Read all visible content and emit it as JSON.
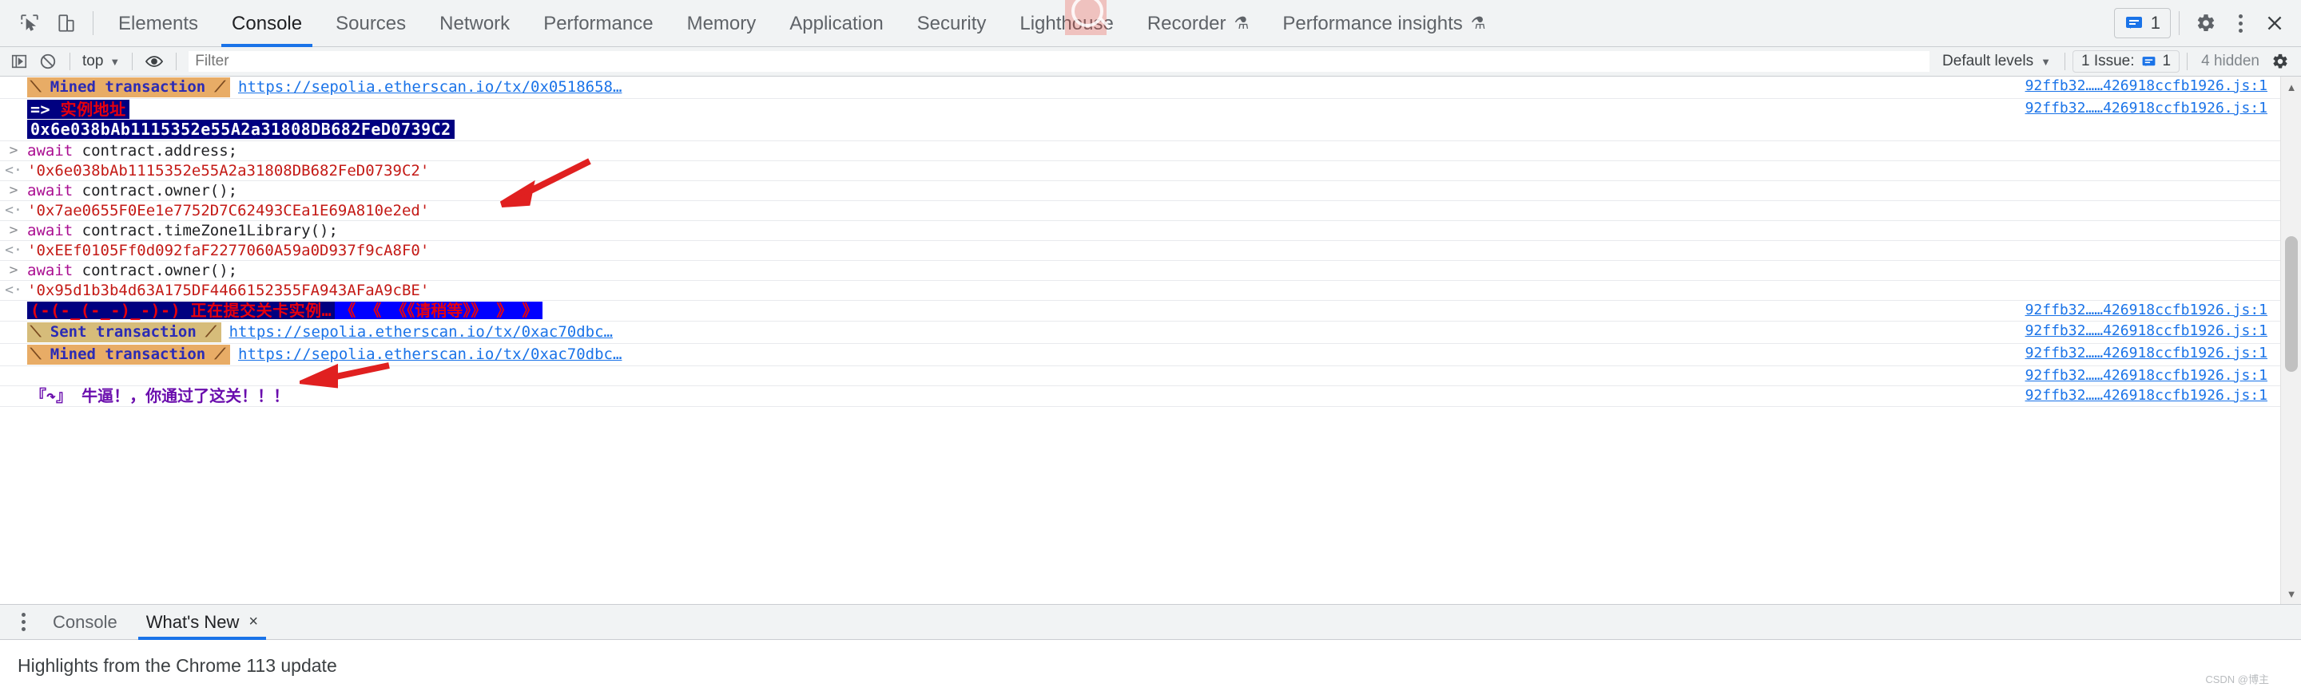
{
  "toolbar": {
    "inspect_icon": "inspect-element-icon",
    "device_icon": "device-toolbar-icon",
    "tabs": [
      {
        "label": "Elements",
        "active": false,
        "badge": ""
      },
      {
        "label": "Console",
        "active": true,
        "badge": ""
      },
      {
        "label": "Sources",
        "active": false,
        "badge": ""
      },
      {
        "label": "Network",
        "active": false,
        "badge": ""
      },
      {
        "label": "Performance",
        "active": false,
        "badge": ""
      },
      {
        "label": "Memory",
        "active": false,
        "badge": ""
      },
      {
        "label": "Application",
        "active": false,
        "badge": ""
      },
      {
        "label": "Security",
        "active": false,
        "badge": ""
      },
      {
        "label": "Lighthouse",
        "active": false,
        "badge": ""
      },
      {
        "label": "Recorder",
        "active": false,
        "badge": "⚗"
      },
      {
        "label": "Performance insights",
        "active": false,
        "badge": "⚗"
      }
    ],
    "issues_badge_count": "1",
    "settings_label": "gear-icon",
    "more_label": "more-options-icon",
    "close_label": "close-icon"
  },
  "console_toolbar": {
    "sidebar_toggle": "console-sidebar-toggle",
    "clear_label": "clear-console-icon",
    "context": "top",
    "eye_label": "live-expressions-icon",
    "filter_placeholder": "Filter",
    "filter_value": "",
    "levels": "Default levels",
    "issues_text": "1 Issue:",
    "issues_count": "1",
    "hidden_text": "4 hidden",
    "settings_label": "console-settings-icon"
  },
  "console": {
    "rows": [
      {
        "type": "styled-badge",
        "gutter": "",
        "badge": "Mined transaction",
        "badge_variant": "mined",
        "link": "https://sepolia.etherscan.io/tx/0x0518658…",
        "source": "92ffb32……426918ccfb1926.js:1"
      },
      {
        "type": "navy-two-line",
        "gutter": "",
        "line1_prefix": "=>",
        "line1": "实例地址",
        "line2": "0x6e038bAb1115352e55A2a31808DB682FeD0739C2",
        "source": "92ffb32……426918ccfb1926.js:1"
      },
      {
        "type": "input",
        "gutter": ">",
        "keyword": "await",
        "code": " contract.address;",
        "source": ""
      },
      {
        "type": "output",
        "gutter": "<·",
        "value": "'0x6e038bAb1115352e55A2a31808DB682FeD0739C2'",
        "source": ""
      },
      {
        "type": "input",
        "gutter": ">",
        "keyword": "await",
        "code": " contract.owner();",
        "source": ""
      },
      {
        "type": "output",
        "gutter": "<·",
        "value": "'0x7ae0655F0Ee1e7752D7C62493CEa1E69A810e2ed'",
        "source": ""
      },
      {
        "type": "input",
        "gutter": ">",
        "keyword": "await",
        "code": " contract.timeZone1Library();",
        "source": ""
      },
      {
        "type": "output",
        "gutter": "<·",
        "value": "'0xEEf0105Ff0d092faF2277060A59a0D937f9cA8F0'",
        "source": ""
      },
      {
        "type": "input",
        "gutter": ">",
        "keyword": "await",
        "code": " contract.owner();",
        "source": ""
      },
      {
        "type": "output",
        "gutter": "<·",
        "value": "'0x95d1b3b4d63A175DF4466152355FA943AFaA9cBE'",
        "source": ""
      },
      {
        "type": "navy-blue-pair",
        "gutter": "",
        "navy_text": "(-(-_(-_-)_-)-) 正在提交关卡实例…",
        "blue_text": "《 《 《《请稍等》》 》 》",
        "source": "92ffb32……426918ccfb1926.js:1"
      },
      {
        "type": "styled-badge",
        "gutter": "",
        "badge": "Sent transaction",
        "badge_variant": "sent",
        "link": "https://sepolia.etherscan.io/tx/0xac70dbc…",
        "source": "92ffb32……426918ccfb1926.js:1"
      },
      {
        "type": "styled-badge",
        "gutter": "",
        "badge": "Mined transaction",
        "badge_variant": "mined",
        "link": "https://sepolia.etherscan.io/tx/0xac70dbc…",
        "source": "92ffb32……426918ccfb1926.js:1"
      },
      {
        "type": "blank",
        "gutter": "",
        "source": "92ffb32……426918ccfb1926.js:1"
      },
      {
        "type": "purple",
        "gutter": "",
        "text": "『↷』 牛逼！，你通过了这关！！！",
        "source": "92ffb32……426918ccfb1926.js:1"
      }
    ]
  },
  "drawer": {
    "tabs": [
      {
        "label": "Console",
        "active": false,
        "closable": false
      },
      {
        "label": "What's New",
        "active": true,
        "closable": true
      }
    ],
    "close_glyph": "×",
    "content_text": "Highlights from the Chrome 113 update"
  },
  "watermark": "CSDN @博主",
  "colors": {
    "accent": "#1a73e8",
    "toolbar_bg": "#f1f3f4",
    "mined_badge_bg": "#e8ac66",
    "sent_badge_bg": "#d6bc7a",
    "navy_bg": "#000080",
    "blue_bg": "#0000ff",
    "error_red": "#e8000d",
    "output_red": "#c41a16",
    "purple": "#6a0dad",
    "arrow_red": "#e02020"
  }
}
